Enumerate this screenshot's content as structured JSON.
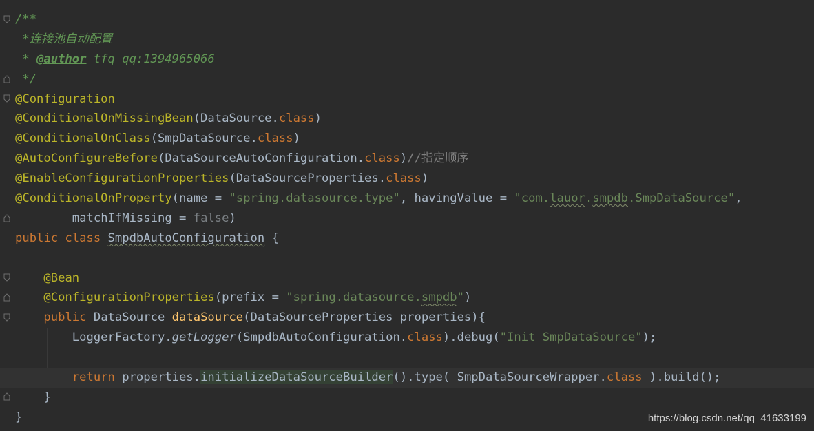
{
  "editor": {
    "lines": {
      "l01": [
        "/**"
      ],
      "l02": [
        " *连接池自动配置"
      ],
      "l03": [
        " * ",
        "@author",
        " tfq qq:1394965066"
      ],
      "l04": [
        " */"
      ],
      "l05": [
        "@Configuration"
      ],
      "l06": [
        "@ConditionalOnMissingBean",
        "(DataSource.",
        "class",
        ")"
      ],
      "l07": [
        "@ConditionalOnClass",
        "(SmpDataSource.",
        "class",
        ")"
      ],
      "l08": [
        "@AutoConfigureBefore",
        "(DataSourceAutoConfiguration.",
        "class",
        ")",
        "//指定顺序"
      ],
      "l09": [
        "@EnableConfigurationProperties",
        "(DataSourceProperties.",
        "class",
        ")"
      ],
      "l10": [
        "@ConditionalOnProperty",
        "(",
        "name",
        " = ",
        "\"spring.datasource.type\"",
        ", ",
        "havingValue",
        " = ",
        "\"com.",
        "lauor",
        ".",
        "smpdb",
        ".SmpDataSource\"",
        ","
      ],
      "l11": [
        "        ",
        "matchIfMissing",
        " = ",
        "false",
        ")"
      ],
      "l12": [
        "public class ",
        "SmpdbAutoConfiguration",
        " {"
      ],
      "l13": [
        ""
      ],
      "l14": [
        "    ",
        "@Bean"
      ],
      "l15": [
        "    ",
        "@ConfigurationProperties",
        "(",
        "prefix",
        " = ",
        "\"spring.datasource.",
        "smpdb",
        "\"",
        ")"
      ],
      "l16": [
        "    ",
        "public ",
        "DataSource ",
        "dataSource",
        "(DataSourceProperties properties){"
      ],
      "l17": [
        "        LoggerFactory.",
        "getLogger",
        "(SmpdbAutoConfiguration.",
        "class",
        ").debug(",
        "\"Init SmpDataSource\"",
        ");"
      ],
      "l18": [
        ""
      ],
      "l19": [
        "        ",
        "return ",
        "properties.",
        "initialize",
        "DataSourceBuilder",
        "().type( SmpDataSourceWrapper.",
        "class",
        " ).build();"
      ],
      "l20": [
        "    }"
      ],
      "l21": [
        "}"
      ]
    }
  },
  "watermark": "https://blog.csdn.net/qq_41633199"
}
